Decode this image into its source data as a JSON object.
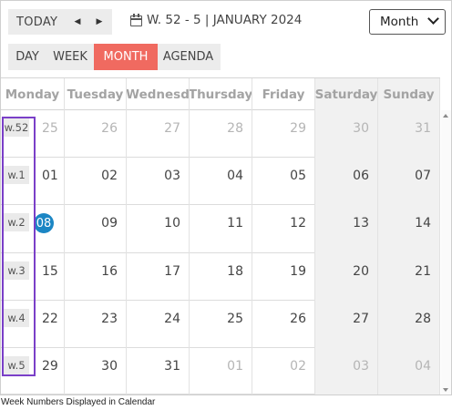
{
  "toolbar": {
    "today_label": "TODAY",
    "prev_icon": "◀",
    "next_icon": "▶",
    "date_range": "W. 52 - 5 | JANUARY 2024",
    "view_select_value": "Month",
    "views": [
      "DAY",
      "WEEK",
      "MONTH",
      "AGENDA"
    ],
    "active_view": "MONTH"
  },
  "calendar": {
    "days": [
      "Monday",
      "Tuesday",
      "Wednesd",
      "Thursday",
      "Friday",
      "Saturday",
      "Sunday"
    ],
    "weeks": [
      {
        "label": "w.52",
        "dates": [
          "25",
          "26",
          "27",
          "28",
          "29",
          "30",
          "31"
        ],
        "other_month": [
          true,
          true,
          true,
          true,
          true,
          true,
          true
        ]
      },
      {
        "label": "w.1",
        "dates": [
          "01",
          "02",
          "03",
          "04",
          "05",
          "06",
          "07"
        ],
        "other_month": [
          false,
          false,
          false,
          false,
          false,
          false,
          false
        ]
      },
      {
        "label": "w.2",
        "dates": [
          "08",
          "09",
          "10",
          "11",
          "12",
          "13",
          "14"
        ],
        "other_month": [
          false,
          false,
          false,
          false,
          false,
          false,
          false
        ]
      },
      {
        "label": "w.3",
        "dates": [
          "15",
          "16",
          "17",
          "18",
          "19",
          "20",
          "21"
        ],
        "other_month": [
          false,
          false,
          false,
          false,
          false,
          false,
          false
        ]
      },
      {
        "label": "w.4",
        "dates": [
          "22",
          "23",
          "24",
          "25",
          "26",
          "27",
          "28"
        ],
        "other_month": [
          false,
          false,
          false,
          false,
          false,
          false,
          false
        ]
      },
      {
        "label": "w.5",
        "dates": [
          "29",
          "30",
          "31",
          "01",
          "02",
          "03",
          "04"
        ],
        "other_month": [
          false,
          false,
          false,
          true,
          true,
          true,
          true
        ]
      }
    ],
    "today": "08"
  },
  "colors": {
    "accent": "#f06a60",
    "today": "#1b86c4",
    "highlight_box": "#7a3fc8"
  },
  "caption": "Week Numbers Displayed in Calendar"
}
